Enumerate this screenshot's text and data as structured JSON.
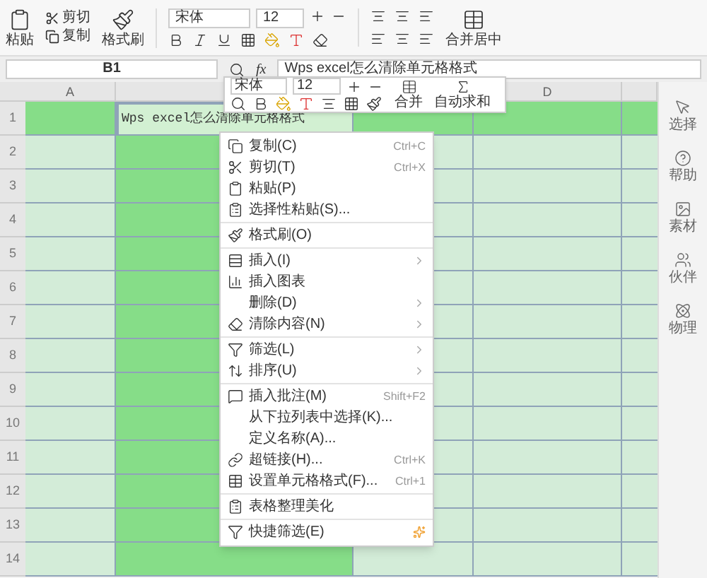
{
  "ribbon": {
    "paste": "粘贴",
    "cut": "剪切",
    "copy": "复制",
    "format_painter": "格式刷",
    "font": "宋体",
    "size": "12",
    "merge": "合并居中"
  },
  "formula_bar": {
    "name_box": "B1",
    "fx": "fx",
    "value": "Wps excel怎么清除单元格格式"
  },
  "mini_toolbar": {
    "font": "宋体",
    "size": "12",
    "merge": "合并",
    "autosum": "自动求和"
  },
  "columns": [
    "A",
    "D"
  ],
  "rows": [
    "1",
    "2",
    "3",
    "4",
    "5",
    "6",
    "7",
    "8",
    "9",
    "10",
    "11",
    "12",
    "13",
    "14"
  ],
  "cell_b1": "Wps excel怎么清除单元格格式",
  "context_menu": [
    {
      "kind": "item",
      "label": "复制(C)",
      "shortcut": "Ctrl+C"
    },
    {
      "kind": "item",
      "label": "剪切(T)",
      "shortcut": "Ctrl+X"
    },
    {
      "kind": "item",
      "label": "粘贴(P)"
    },
    {
      "kind": "item",
      "label": "选择性粘贴(S)..."
    },
    {
      "kind": "separator"
    },
    {
      "kind": "item",
      "label": "格式刷(O)"
    },
    {
      "kind": "separator"
    },
    {
      "kind": "item",
      "label": "插入(I)",
      "submenu": true
    },
    {
      "kind": "item",
      "label": "插入图表"
    },
    {
      "kind": "item",
      "label": "删除(D)",
      "submenu": true
    },
    {
      "kind": "item",
      "label": "清除内容(N)",
      "submenu": true
    },
    {
      "kind": "separator"
    },
    {
      "kind": "item",
      "label": "筛选(L)",
      "submenu": true
    },
    {
      "kind": "item",
      "label": "排序(U)",
      "submenu": true
    },
    {
      "kind": "separator"
    },
    {
      "kind": "item",
      "label": "插入批注(M)",
      "shortcut": "Shift+F2"
    },
    {
      "kind": "item",
      "label": "从下拉列表中选择(K)..."
    },
    {
      "kind": "item",
      "label": "定义名称(A)..."
    },
    {
      "kind": "item",
      "label": "超链接(H)...",
      "shortcut": "Ctrl+K"
    },
    {
      "kind": "item",
      "label": "设置单元格格式(F)...",
      "shortcut": "Ctrl+1"
    },
    {
      "kind": "separator"
    },
    {
      "kind": "item",
      "label": "表格整理美化"
    },
    {
      "kind": "separator"
    },
    {
      "kind": "item",
      "label": "快捷筛选(E)"
    }
  ],
  "side_panel": [
    {
      "label": "选择"
    },
    {
      "label": "帮助"
    },
    {
      "label": "素材"
    },
    {
      "label": "伙伴"
    },
    {
      "label": "物理"
    }
  ]
}
